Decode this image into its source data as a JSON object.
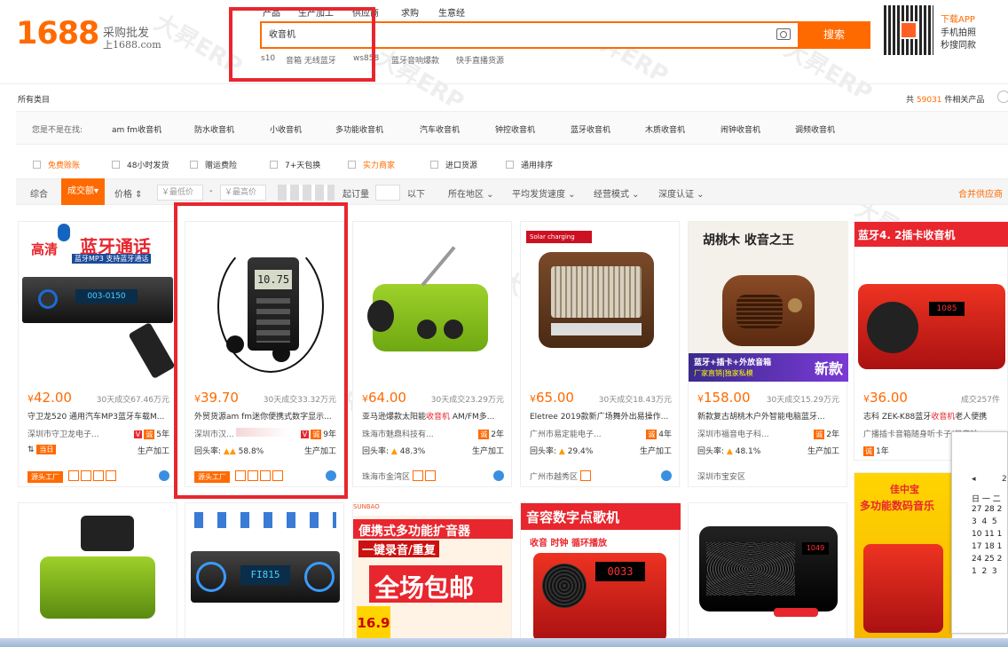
{
  "header": {
    "logo_number": "1688",
    "logo_slogan": "采购批发",
    "logo_sub": "上1688.com",
    "nav": [
      "产品",
      "生产加工",
      "供应商",
      "求购",
      "生意经"
    ],
    "search_value": "收音机",
    "search_button": "搜索",
    "hot_words": [
      "s10",
      "音箱 无线蓝牙",
      "ws858",
      "蓝牙音响爆款",
      "快手直播货源"
    ],
    "app_title": "下载APP",
    "app_line1": "手机拍照",
    "app_line2": "秒搜同款"
  },
  "categories": {
    "all_label": "所有类目",
    "result_prefix": "共",
    "result_count": "59031",
    "result_suffix": "件相关产品",
    "related_label": "您是不是在找:",
    "related": [
      "am fm收音机",
      "防水收音机",
      "小收音机",
      "多功能收音机",
      "汽车收音机",
      "钟控收音机",
      "蓝牙收音机",
      "木质收音机",
      "闹钟收音机",
      "调频收音机"
    ]
  },
  "filters": [
    "免费赊账",
    "48小时发货",
    "赠运费险",
    "7+天包换",
    "实力商家",
    "进口货源",
    "通用排序"
  ],
  "sortbar": {
    "items": [
      "综合",
      "成交额",
      "价格",
      "起订量",
      "以下",
      "所在地区",
      "平均发货速度",
      "经营模式",
      "深度认证"
    ],
    "active": "成交额",
    "min_price": "￥最低价",
    "max_price": "￥最高价",
    "dash": "-",
    "merge": "合并供应商"
  },
  "products": [
    {
      "price_symbol": "¥",
      "price": "42.00",
      "sales": "30天成交67.46万元",
      "title": "守卫龙520 通用汽车MP3蓝牙车载M...",
      "title_hl": "",
      "location": "深圳市守卫龙电子...",
      "years": "5年",
      "rate_label": "",
      "rate": "",
      "proc": "生产加工",
      "badge": "源头工厂",
      "today": "当日"
    },
    {
      "price_symbol": "¥",
      "price": "39.70",
      "sales": "30天成交33.32万元",
      "title": "外贸货源am fm迷你便携式数字显示...",
      "title_hl": "",
      "location": "深圳市汉...",
      "years": "9年",
      "rate_label": "回头率:",
      "rate": "58.8%",
      "proc": "生产加工",
      "badge": "源头工厂",
      "today": ""
    },
    {
      "price_symbol": "¥",
      "price": "64.00",
      "sales": "30天成交23.29万元",
      "title": "亚马逊爆款太阳能",
      "title_hl": "收音机",
      "title_tail": " AM/FM多...",
      "location": "珠海市魅鼎科技有...",
      "years": "2年",
      "rate_label": "回头率:",
      "rate": "48.3%",
      "proc": "生产加工",
      "badge": "",
      "today": "",
      "region": "珠海市金湾区"
    },
    {
      "price_symbol": "¥",
      "price": "65.00",
      "sales": "30天成交18.43万元",
      "title": "Eletree 2019款新广场舞外出易操作...",
      "title_hl": "",
      "location": "广州市易定能电子...",
      "years": "4年",
      "rate_label": "回头率:",
      "rate": "29.4%",
      "proc": "生产加工",
      "badge": "",
      "today": "",
      "region": "广州市越秀区"
    },
    {
      "price_symbol": "¥",
      "price": "158.00",
      "sales": "30天成交15.29万元",
      "title": "新款复古胡桃木户外智能电脑蓝牙...",
      "title_hl": "",
      "location": "深圳市福音电子科...",
      "years": "2年",
      "rate_label": "回头率:",
      "rate": "48.1%",
      "proc": "生产加工",
      "badge": "",
      "today": "",
      "region": "深圳市宝安区"
    },
    {
      "price_symbol": "¥",
      "price": "36.00",
      "sales": "成交257件",
      "title": "志科 ZEK-K88蓝牙",
      "title_hl": "收音机",
      "title_tail": "老人便携",
      "title2": "广播插卡音箱随身听卡子(只音响",
      "location": "",
      "years": "1年",
      "rate_label": "",
      "rate": "",
      "proc": "",
      "badge": "",
      "today": ""
    }
  ],
  "product_images": {
    "p1_banner": "蓝牙通话",
    "p1_sub": "高清",
    "p1_tag": "蓝牙MP3 支持蓝牙通话",
    "p2_screen": "10.75",
    "p5_title": "胡桃木 收音之王",
    "p5_bottom": "蓝牙+插卡+外放音箱",
    "p5_new": "新款",
    "p5_factory": "厂家直销|独家私模",
    "p6_title": "蓝牙4. 2插卡收音机",
    "r2_banner": "便携式多功能扩音器",
    "r2_sub": "一键录音/重复",
    "r2_big": "全场包邮",
    "r2_price": "16.9",
    "r3_banner": "音容数字点歌机",
    "r3_sub": "收音 时钟 循环播放",
    "r5_banner": "佳中宝",
    "r5_title": "多功能数码音乐"
  },
  "calendar": {
    "month": "2",
    "rows": [
      "日 一 二",
      "27 28 2",
      "3  4  5",
      "10 11 1",
      "17 18 1",
      "24 25 2",
      "1  2  3"
    ]
  },
  "watermark": "大昇ERP"
}
